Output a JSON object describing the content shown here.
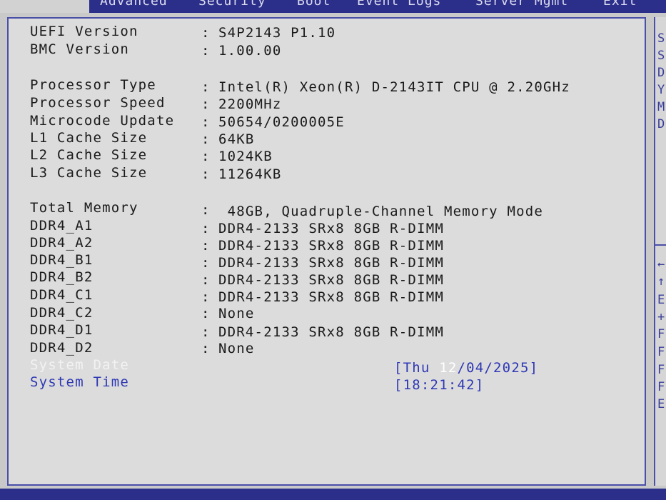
{
  "menu": {
    "items": [
      "Advanced",
      "Security",
      "Boot",
      "Event Logs",
      "Server Mgmt",
      "Exit"
    ]
  },
  "info_rows": [
    {
      "label": "UEFI Version",
      "value": "S4P2143 P1.10"
    },
    {
      "label": "BMC Version",
      "value": "1.00.00"
    },
    {
      "label": "Processor Type",
      "value": "Intel(R) Xeon(R) D-2143IT CPU @ 2.20GHz"
    },
    {
      "label": "Processor Speed",
      "value": "2200MHz"
    },
    {
      "label": "Microcode Update",
      "value": "50654/0200005E"
    },
    {
      "label": "L1 Cache Size",
      "value": "64KB"
    },
    {
      "label": "L2 Cache Size",
      "value": "1024KB"
    },
    {
      "label": "L3 Cache Size",
      "value": "11264KB"
    },
    {
      "label": "Total Memory",
      "value": " 48GB, Quadruple-Channel Memory Mode"
    },
    {
      "label": "DDR4_A1",
      "value": "DDR4-2133 SRx8 8GB R-DIMM"
    },
    {
      "label": "DDR4_A2",
      "value": "DDR4-2133 SRx8 8GB R-DIMM"
    },
    {
      "label": "DDR4_B1",
      "value": "DDR4-2133 SRx8 8GB R-DIMM"
    },
    {
      "label": "DDR4_B2",
      "value": "DDR4-2133 SRx8 8GB R-DIMM"
    },
    {
      "label": "DDR4_C1",
      "value": "DDR4-2133 SRx8 8GB R-DIMM"
    },
    {
      "label": "DDR4_C2",
      "value": "None"
    },
    {
      "label": "DDR4_D1",
      "value": "DDR4-2133 SRx8 8GB R-DIMM"
    },
    {
      "label": "DDR4_D2",
      "value": "None"
    }
  ],
  "colon": ":",
  "system_date": {
    "label": "System Date",
    "prefix": "[Thu ",
    "selected": "12",
    "suffix": "/04/2025]"
  },
  "system_time": {
    "label": "System Time",
    "value": "[18:21:42]"
  },
  "help_glyphs": [
    "S",
    "S",
    "D",
    "Y",
    "M",
    "D",
    "←",
    "↑",
    "E",
    "+",
    "F",
    "F",
    "F",
    "F",
    "E"
  ],
  "colors": {
    "menubar": "#2c2f8a",
    "border": "#4a4fa8",
    "panel": "#dcdcdc",
    "selectable_text": "#2e38b4"
  }
}
